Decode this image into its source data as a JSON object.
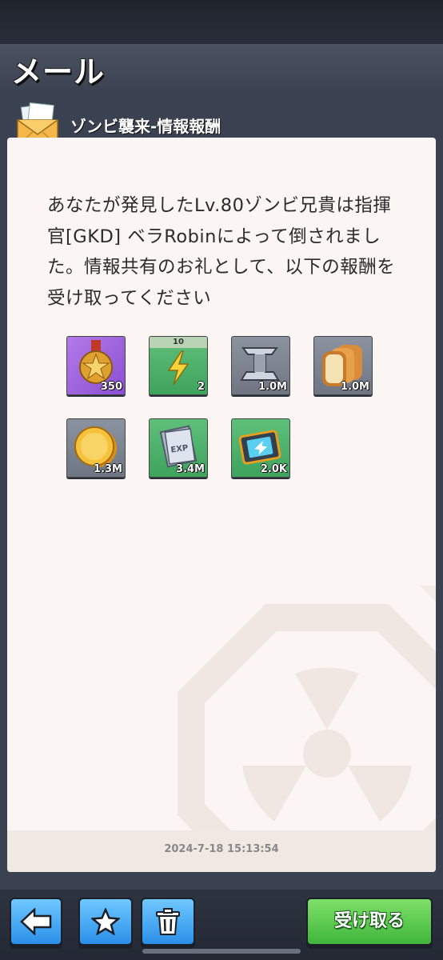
{
  "header": {
    "title": "メール"
  },
  "mail": {
    "subject": "ゾンビ襲来-情報報酬",
    "body": "あなたが発見したLv.80ゾンビ兄貴は指揮官[GKD] ベラRobinによって倒されました。情報共有のお礼として、以下の報酬を受け取ってください",
    "timestamp": "2024-7-18 15:13:54"
  },
  "rewards": [
    {
      "icon": "medal-icon",
      "qty": "350",
      "bg": "purple",
      "top": ""
    },
    {
      "icon": "lightning-icon",
      "qty": "2",
      "bg": "green",
      "top": "10"
    },
    {
      "icon": "steel-ingot-icon",
      "qty": "1.0M",
      "bg": "gray",
      "top": ""
    },
    {
      "icon": "bread-icon",
      "qty": "1.0M",
      "bg": "gray",
      "top": ""
    },
    {
      "icon": "gold-coin-icon",
      "qty": "1.3M",
      "bg": "gray",
      "top": ""
    },
    {
      "icon": "exp-book-icon",
      "qty": "3.4M",
      "bg": "green",
      "top": ""
    },
    {
      "icon": "speedup-ticket-icon",
      "qty": "2.0K",
      "bg": "green",
      "top": ""
    }
  ],
  "actions": {
    "claim_label": "受け取る"
  },
  "colors": {
    "accent_green": "#3fb63b",
    "accent_blue": "#2a8fe8",
    "item_purple": "#8b4fd2"
  }
}
